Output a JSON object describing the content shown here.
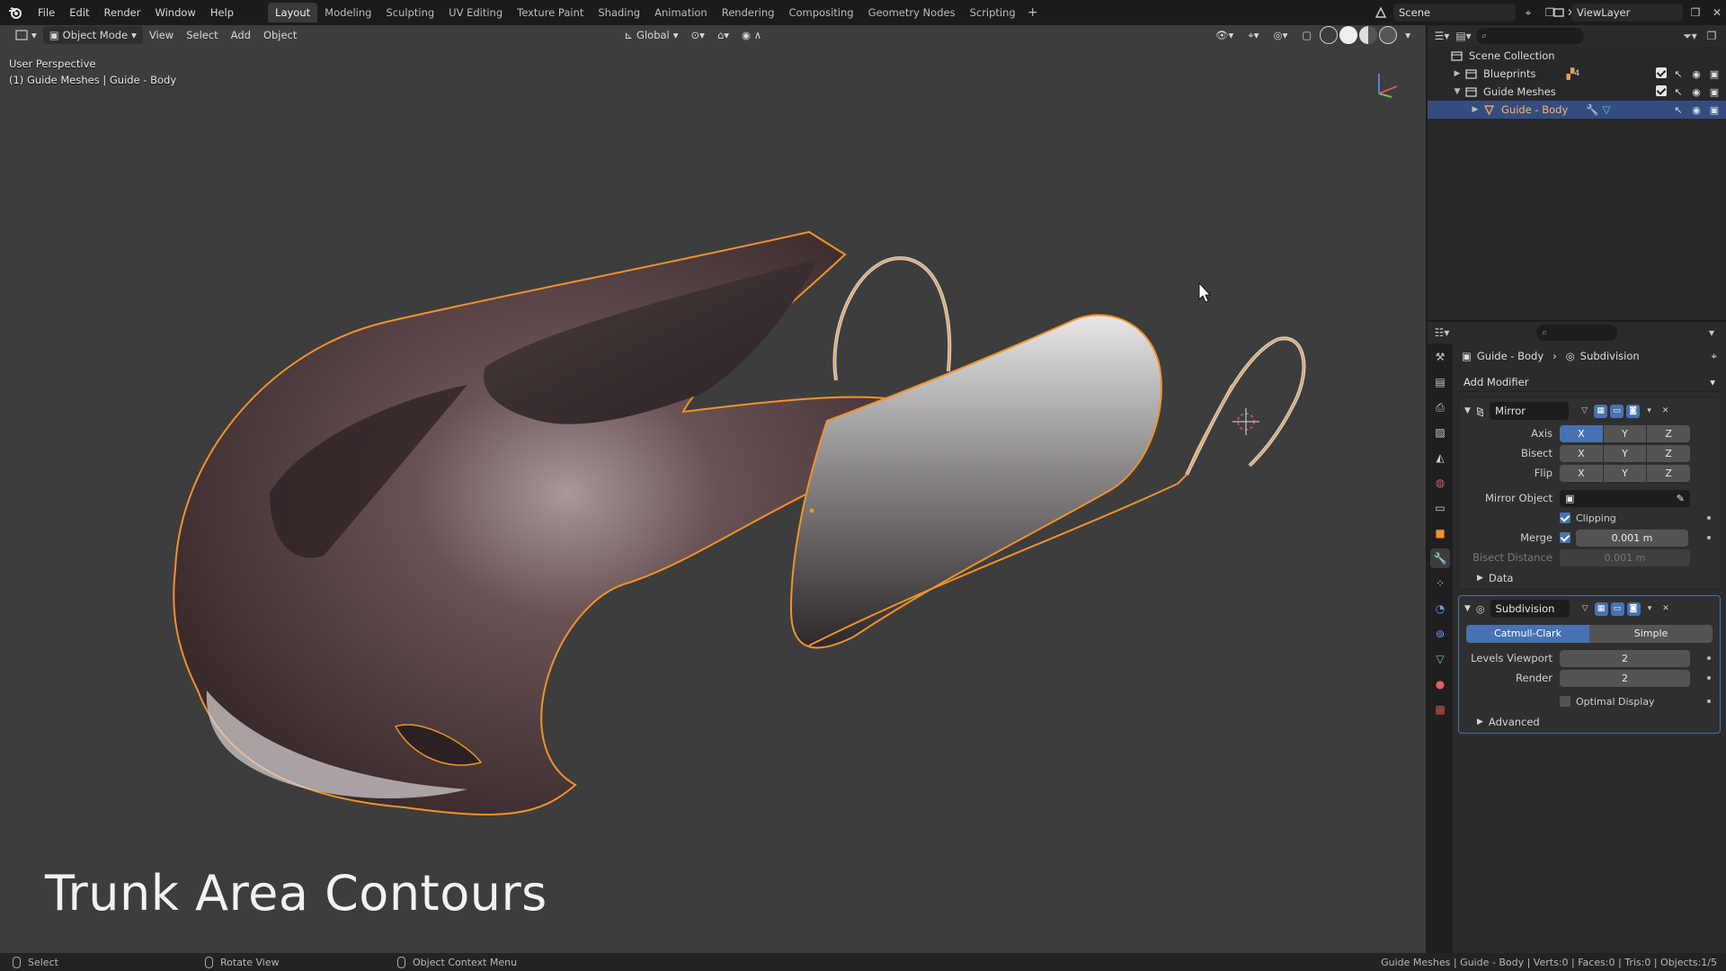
{
  "topbar": {
    "menus": [
      "File",
      "Edit",
      "Render",
      "Window",
      "Help"
    ],
    "workspaces": [
      "Layout",
      "Modeling",
      "Sculpting",
      "UV Editing",
      "Texture Paint",
      "Shading",
      "Animation",
      "Rendering",
      "Compositing",
      "Geometry Nodes",
      "Scripting"
    ],
    "active_workspace": "Layout",
    "add_workspace": "+",
    "scene": "Scene",
    "view_layer": "ViewLayer"
  },
  "viewport": {
    "mode": "Object Mode",
    "menus": [
      "View",
      "Select",
      "Add",
      "Object"
    ],
    "transform_orientation": "Global",
    "perspective": "User Perspective",
    "context": "(1) Guide Meshes | Guide - Body",
    "caption": "Trunk Area Contours",
    "colors": {
      "background": "#3d3d3d",
      "selection_outline": "#f0922b",
      "body": "#5a4446"
    }
  },
  "outliner": {
    "root": "Scene Collection",
    "rows": [
      {
        "label": "Blueprints",
        "badge": "4"
      },
      {
        "label": "Guide Meshes"
      },
      {
        "label": "Guide - Body"
      }
    ]
  },
  "properties": {
    "breadcrumb_object": "Guide - Body",
    "breadcrumb_modifier": "Subdivision",
    "add_modifier": "Add Modifier",
    "mirror": {
      "name": "Mirror",
      "axis_label": "Axis",
      "bisect_label": "Bisect",
      "flip_label": "Flip",
      "xyz": [
        "X",
        "Y",
        "Z"
      ],
      "mirror_object_label": "Mirror Object",
      "clipping_label": "Clipping",
      "merge_label": "Merge",
      "merge_value": "0.001 m",
      "bisect_distance_label": "Bisect Distance",
      "bisect_distance_value": "0.001 m",
      "data_label": "Data"
    },
    "subdivision": {
      "name": "Subdivision",
      "method_catmull": "Catmull-Clark",
      "method_simple": "Simple",
      "levels_viewport_label": "Levels Viewport",
      "levels_viewport_value": "2",
      "render_label": "Render",
      "render_value": "2",
      "optimal_display_label": "Optimal Display",
      "advanced_label": "Advanced"
    }
  },
  "statusbar": {
    "select": "Select",
    "rotate": "Rotate View",
    "context_menu": "Object Context Menu",
    "stats": "Guide Meshes | Guide - Body | Verts:0 | Faces:0 | Tris:0 | Objects:1/5"
  }
}
